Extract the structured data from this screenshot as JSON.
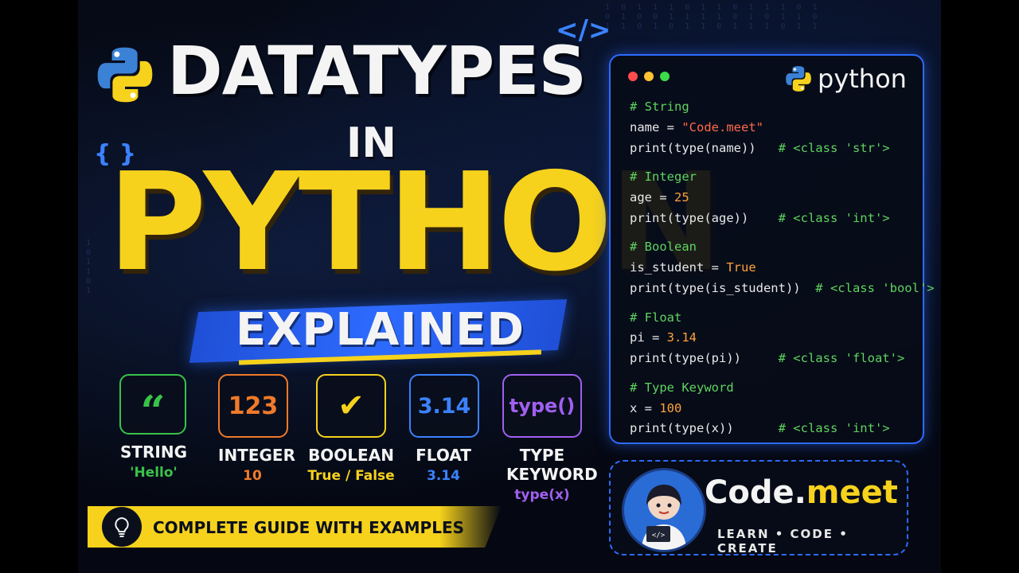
{
  "title": {
    "line1": "DATATYPES",
    "line2": "IN",
    "line3": "PYTHON",
    "line4": "EXPLAINED"
  },
  "types": [
    {
      "icon": "quote-icon",
      "symbol": "“",
      "label": "STRING",
      "example": "'Hello'",
      "color": "#39c24a"
    },
    {
      "icon": "number-icon",
      "symbol": "123",
      "label": "INTEGER",
      "example": "10",
      "color": "#f07a2a"
    },
    {
      "icon": "check-icon",
      "symbol": "✔",
      "label": "BOOLEAN",
      "example": "True / False",
      "color": "#f6d21c"
    },
    {
      "icon": "decimal-icon",
      "symbol": "3.14",
      "label": "FLOAT",
      "example": "3.14",
      "color": "#3b82ff"
    },
    {
      "icon": "function-icon",
      "symbol": "type()",
      "label": "TYPE KEYWORD",
      "example": "type(x)",
      "color": "#a060f0"
    }
  ],
  "banner": {
    "text": "COMPLETE GUIDE WITH EXAMPLES"
  },
  "code_panel": {
    "brand": "python",
    "lines": [
      [
        {
          "t": "# String",
          "c": "cm"
        }
      ],
      [
        {
          "t": "name = ",
          "c": "tx"
        },
        {
          "t": "\"Code.meet\"",
          "c": "st"
        }
      ],
      [
        {
          "t": "print(type(name))   ",
          "c": "tx"
        },
        {
          "t": "# <class 'str'>",
          "c": "cm"
        }
      ],
      [],
      [
        {
          "t": "# Integer",
          "c": "cm"
        }
      ],
      [
        {
          "t": "age = ",
          "c": "tx"
        },
        {
          "t": "25",
          "c": "nm"
        }
      ],
      [
        {
          "t": "print(type(age))    ",
          "c": "tx"
        },
        {
          "t": "# <class 'int'>",
          "c": "cm"
        }
      ],
      [],
      [
        {
          "t": "# Boolean",
          "c": "cm"
        }
      ],
      [
        {
          "t": "is_student = ",
          "c": "tx"
        },
        {
          "t": "True",
          "c": "kw"
        }
      ],
      [
        {
          "t": "print(type(is_student))  ",
          "c": "tx"
        },
        {
          "t": "# <class 'bool'>",
          "c": "cm"
        }
      ],
      [],
      [
        {
          "t": "# Float",
          "c": "cm"
        }
      ],
      [
        {
          "t": "pi = ",
          "c": "tx"
        },
        {
          "t": "3.14",
          "c": "nm"
        }
      ],
      [
        {
          "t": "print(type(pi))     ",
          "c": "tx"
        },
        {
          "t": "# <class 'float'>",
          "c": "cm"
        }
      ],
      [],
      [
        {
          "t": "# Type Keyword",
          "c": "cm"
        }
      ],
      [
        {
          "t": "x = ",
          "c": "tx"
        },
        {
          "t": "100",
          "c": "nm"
        }
      ],
      [
        {
          "t": "print(type(x))      ",
          "c": "tx"
        },
        {
          "t": "# <class 'int'>",
          "c": "cm"
        }
      ]
    ]
  },
  "brand": {
    "name_part1": "Code.",
    "name_part2": "meet",
    "tagline": "LEARN • CODE • CREATE"
  },
  "colors": {
    "accent_blue": "#2d6bff",
    "accent_yellow": "#f6d21c"
  }
}
